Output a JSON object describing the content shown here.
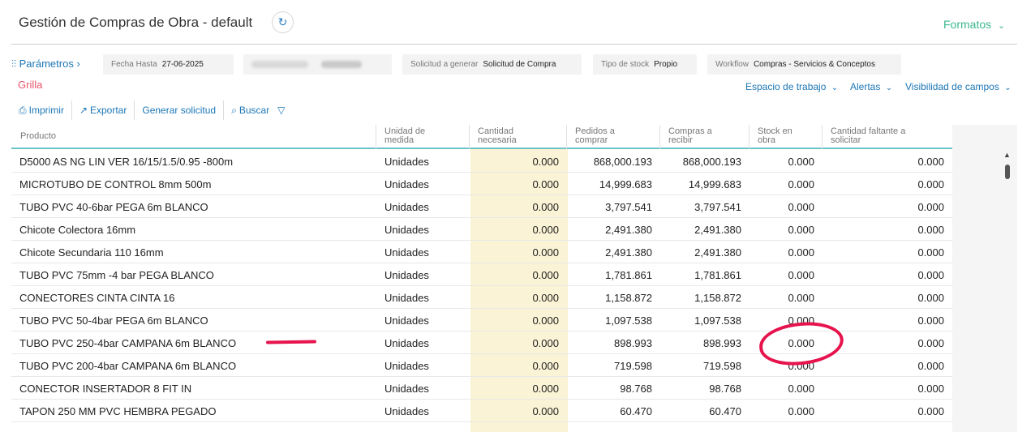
{
  "header": {
    "title": "Gestión de Compras de Obra - default",
    "formatos_label": "Formatos"
  },
  "params": {
    "link_label": "Parámetros",
    "fecha_hasta_label": "Fecha Hasta",
    "fecha_hasta_value": "27-06-2025",
    "solicitud_label": "Solicitud a generar",
    "solicitud_value": "Solicitud de Compra",
    "tipo_stock_label": "Tipo de stock",
    "tipo_stock_value": "Propio",
    "workflow_label": "Workflow",
    "workflow_value": "Compras - Servicios & Conceptos"
  },
  "grilla_label": "Grilla",
  "view_links": {
    "espacio": "Espacio de trabajo",
    "alertas": "Alertas",
    "visibilidad": "Visibilidad de campos"
  },
  "toolbar": {
    "imprimir": "Imprimir",
    "exportar": "Exportar",
    "generar": "Generar solicitud",
    "buscar": "Buscar"
  },
  "table": {
    "columns": [
      "Producto",
      "Unidad de medida",
      "Cantidad necesaria",
      "Pedidos a comprar",
      "Compras a recibir",
      "Stock en obra",
      "Cantidad faltante a solicitar"
    ],
    "rows": [
      [
        "D5000 AS NG LIN VER 16/15/1.5/0.95 -800m",
        "Unidades",
        "0.000",
        "868,000.193",
        "868,000.193",
        "0.000",
        "0.000"
      ],
      [
        "MICROTUBO DE CONTROL 8mm 500m",
        "Unidades",
        "0.000",
        "14,999.683",
        "14,999.683",
        "0.000",
        "0.000"
      ],
      [
        "TUBO PVC 40-6bar PEGA 6m BLANCO",
        "Unidades",
        "0.000",
        "3,797.541",
        "3,797.541",
        "0.000",
        "0.000"
      ],
      [
        "Chicote Colectora 16mm",
        "Unidades",
        "0.000",
        "2,491.380",
        "2,491.380",
        "0.000",
        "0.000"
      ],
      [
        "Chicote Secundaria 110 16mm",
        "Unidades",
        "0.000",
        "2,491.380",
        "2,491.380",
        "0.000",
        "0.000"
      ],
      [
        "TUBO PVC 75mm -4 bar PEGA BLANCO",
        "Unidades",
        "0.000",
        "1,781.861",
        "1,781.861",
        "0.000",
        "0.000"
      ],
      [
        "CONECTORES CINTA CINTA 16",
        "Unidades",
        "0.000",
        "1,158.872",
        "1,158.872",
        "0.000",
        "0.000"
      ],
      [
        "TUBO PVC 50-4bar PEGA 6m BLANCO",
        "Unidades",
        "0.000",
        "1,097.538",
        "1,097.538",
        "0.000",
        "0.000"
      ],
      [
        "TUBO PVC 250-4bar CAMPANA 6m BLANCO",
        "Unidades",
        "0.000",
        "898.993",
        "898.993",
        "0.000",
        "0.000"
      ],
      [
        "TUBO PVC 200-4bar CAMPANA 6m BLANCO",
        "Unidades",
        "0.000",
        "719.598",
        "719.598",
        "0.000",
        "0.000"
      ],
      [
        "CONECTOR INSERTADOR 8 FIT IN",
        "Unidades",
        "0.000",
        "98.768",
        "98.768",
        "0.000",
        "0.000"
      ],
      [
        "TAPON 250 MM PVC HEMBRA PEGADO",
        "Unidades",
        "0.000",
        "60.470",
        "60.470",
        "0.000",
        "0.000"
      ]
    ]
  },
  "colors": {
    "accent_blue": "#1d77b6",
    "accent_green": "#3bb98b",
    "grilla_red": "#e8546a",
    "annotation_red": "#e6134d",
    "highlight_yellow": "#fbf3d5"
  }
}
